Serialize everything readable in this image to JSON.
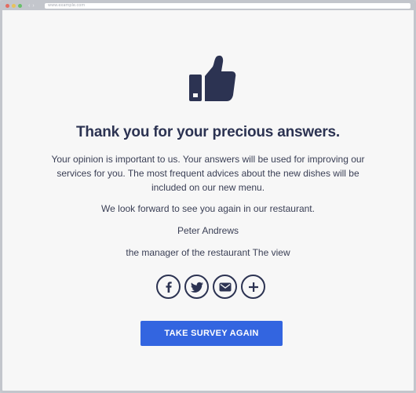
{
  "browser": {
    "url": "www.example.com",
    "back_glyph": "‹",
    "forward_glyph": "›"
  },
  "icons": {
    "thumb": "thumbs-up-icon",
    "facebook": "facebook-icon",
    "twitter": "twitter-icon",
    "email": "email-icon",
    "more": "plus-icon"
  },
  "colors": {
    "accent": "#3365e0",
    "ink": "#2c3352",
    "background": "#f7f7f7"
  },
  "thanks": {
    "title": "Thank you for your precious answers.",
    "message": "Your opinion is important to us. Your answers will be used for improving our services for you. The most frequent advices about the new dishes will be included on our new menu.",
    "farewell": "We look forward to see you again in our restaurant.",
    "signature_name": "Peter Andrews",
    "signature_role": "the manager of the restaurant The view"
  },
  "actions": {
    "retake_label": "TAKE SURVEY AGAIN"
  }
}
